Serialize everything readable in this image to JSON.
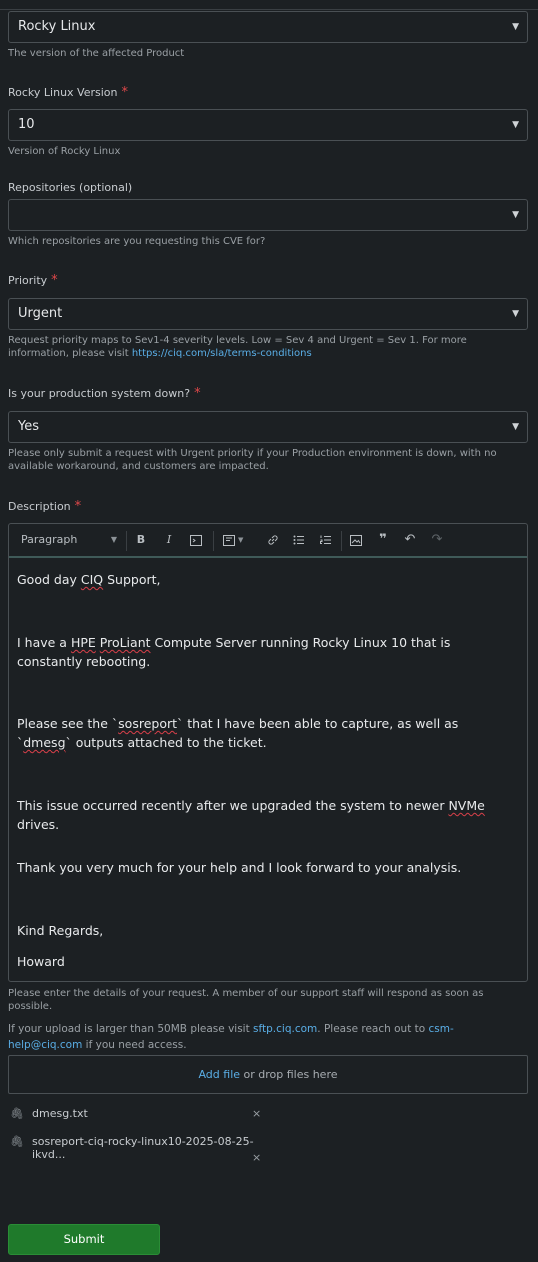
{
  "product": {
    "value": "Rocky Linux",
    "hint": "The version of the affected Product"
  },
  "version": {
    "label": "Rocky Linux Version",
    "required": "*",
    "value": "10",
    "hint": "Version of Rocky Linux"
  },
  "repositories": {
    "label": "Repositories (optional)",
    "value": "",
    "hint": "Which repositories are you requesting this CVE for?"
  },
  "priority": {
    "label": "Priority",
    "required": "*",
    "value": "Urgent",
    "hint": "Request priority maps to Sev1-4 severity levels. Low = Sev 4 and Urgent = Sev 1. For more information, please visit ",
    "hint_link": "https://ciq.com/sla/terms-conditions"
  },
  "production_down": {
    "label": "Is your production system down?",
    "required": "*",
    "value": "Yes",
    "hint": "Please only submit a request with Urgent priority if your Production environment is down, with no available workaround, and customers are impacted."
  },
  "description": {
    "label": "Description",
    "required": "*",
    "block_format": "Paragraph",
    "hint": "Please enter the details of your request. A member of our support staff will respond as soon as possible.",
    "body": {
      "p1_a": "Good day ",
      "p1_b": "CIQ",
      "p1_c": " Support,",
      "p2_a": "I have a ",
      "p2_b": "HPE",
      "p2_c": " ",
      "p2_d": "ProLiant",
      "p2_e": " Compute Server running Rocky Linux 10 that is constantly rebooting.",
      "p3_a": "Please see the `",
      "p3_b": "sosreport",
      "p3_c": "` that I have been able to capture, as well as `",
      "p3_d": "dmesg",
      "p3_e": "` outputs attached to the ticket.",
      "p4_a": "This issue occurred recently after we upgraded the system to newer ",
      "p4_b": "NVMe",
      "p4_c": " drives.",
      "p5": "Thank you very much for your help and I look forward to your analysis.",
      "p6": "Kind Regards,",
      "p7": "Howard"
    }
  },
  "upload": {
    "note_a": "If your upload is larger than 50MB please visit ",
    "note_link1": "sftp.ciq.com",
    "note_b": ". Please reach out to ",
    "note_link2": "csm-help@ciq.com",
    "note_c": " if you need access.",
    "add_file": "Add file",
    "drop_text": " or drop files here",
    "files": [
      {
        "name": "dmesg.txt",
        "remove": "×"
      },
      {
        "name": "sosreport-ciq-rocky-linux10-2025-08-25-ikvd...",
        "remove": "×"
      }
    ]
  },
  "submit_label": "Submit"
}
